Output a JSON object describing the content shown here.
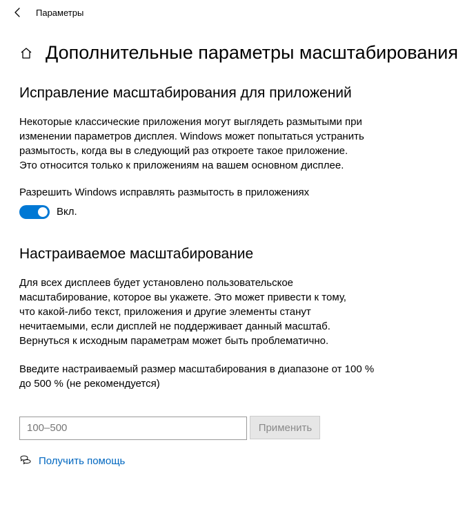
{
  "window": {
    "title": "Параметры"
  },
  "page": {
    "title": "Дополнительные параметры масштабирования"
  },
  "section_fix": {
    "heading": "Исправление масштабирования для приложений",
    "desc": "Некоторые классические приложения могут выглядеть размытыми при изменении параметров дисплея. Windows может попытаться устранить размытость, когда вы в следующий раз откроете такое приложение. Это относится только к приложениям на вашем основном дисплее.",
    "toggle_label": "Разрешить Windows исправлять размытость в приложениях",
    "toggle_state_label": "Вкл.",
    "toggle_on": true
  },
  "section_custom": {
    "heading": "Настраиваемое масштабирование",
    "desc": "Для всех дисплеев будет установлено пользовательское масштабирование, которое вы укажете. Это может привести к тому, что какой-либо текст, приложения и другие элементы станут нечитаемыми, если дисплей не поддерживает данный масштаб. Вернуться к исходным параметрам может быть проблематично.",
    "input_label": "Введите настраиваемый размер масштабирования в диапазоне от 100 % до 500 % (не рекомендуется)",
    "input_placeholder": "100–500",
    "input_value": "",
    "apply_label": "Применить"
  },
  "footer": {
    "help_link": "Получить помощь"
  },
  "colors": {
    "accent": "#0078d4",
    "link": "#0067c0"
  }
}
